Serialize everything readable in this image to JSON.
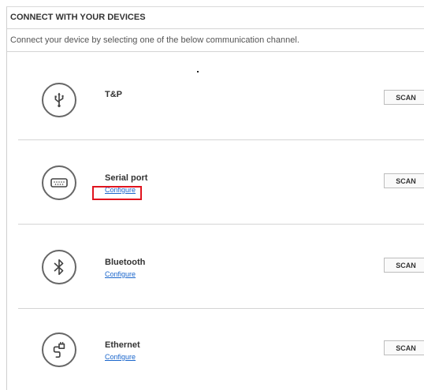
{
  "header": {
    "title": "CONNECT WITH YOUR DEVICES"
  },
  "subtitle": "Connect your device by selecting one of the below communication channel.",
  "devices": [
    {
      "name": "T&P",
      "icon": "usb-icon",
      "configure": null,
      "scan": "SCAN"
    },
    {
      "name": "Serial port",
      "icon": "serial-port-icon",
      "configure": "Configure",
      "scan": "SCAN"
    },
    {
      "name": "Bluetooth",
      "icon": "bluetooth-icon",
      "configure": "Configure",
      "scan": "SCAN"
    },
    {
      "name": "Ethernet",
      "icon": "ethernet-icon",
      "configure": "Configure",
      "scan": "SCAN"
    }
  ],
  "colors": {
    "link": "#1a66cc",
    "highlight": "#e0141e",
    "border": "#d4d4d4"
  }
}
